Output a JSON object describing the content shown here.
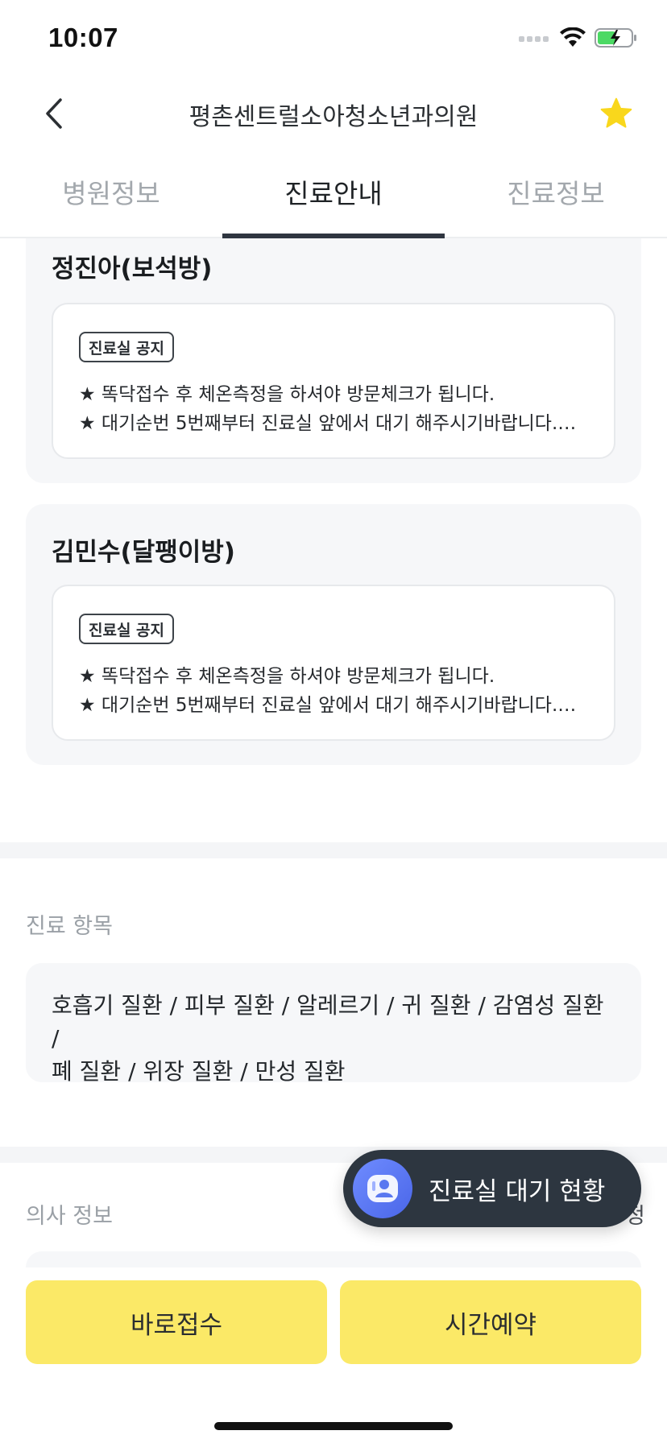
{
  "status_bar": {
    "time": "10:07"
  },
  "nav": {
    "title": "평촌센트럴소아청소년과의원"
  },
  "tabs": [
    {
      "label": "병원정보",
      "active": false
    },
    {
      "label": "진료안내",
      "active": true
    },
    {
      "label": "진료정보",
      "active": false
    }
  ],
  "rooms": [
    {
      "name": "정진아(보석방)",
      "badge": "진료실 공지",
      "lines": [
        "★ 똑닥접수 후 체온측정을 하셔야 방문체크가 됩니다.",
        "★ 대기순번 5번째부터 진료실 앞에서 대기 해주시기바랍니다.…"
      ]
    },
    {
      "name": "김민수(달팽이방)",
      "badge": "진료실 공지",
      "lines": [
        "★ 똑닥접수 후 체온측정을 하셔야 방문체크가 됩니다.",
        "★ 대기순번 5번째부터 진료실 앞에서 대기 해주시기바랍니다.…"
      ]
    }
  ],
  "treatment": {
    "label": "진료 항목",
    "text_line1": "호흡기 질환 / 피부 질환 / 알레르기 / 귀 질환 / 감염성 질환 /",
    "text_line2": "폐 질환 / 위장 질환 / 만성 질환"
  },
  "doctor": {
    "label": "의사 정보",
    "peek_text": "정"
  },
  "wait_pill": {
    "label": "진료실 대기 현황"
  },
  "actions": {
    "walk_in": "바로접수",
    "reserve": "시간예약"
  },
  "colors": {
    "accent_yellow": "#FBE967",
    "star": "#F9D71C",
    "pill_bg": "#2D3640",
    "avatar": "#5A78F0",
    "battery": "#4CD964"
  }
}
